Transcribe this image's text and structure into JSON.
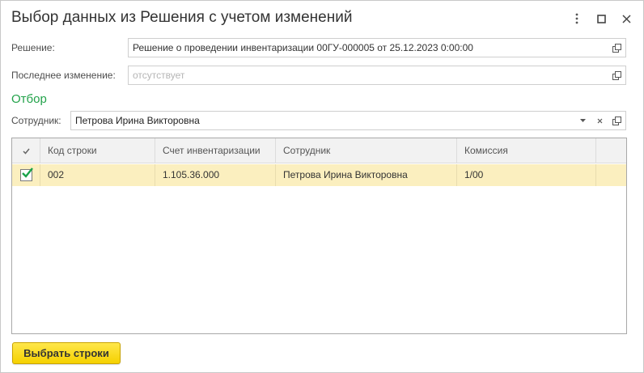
{
  "window": {
    "title": "Выбор данных из Решения с учетом изменений"
  },
  "form": {
    "decision_label": "Решение:",
    "decision_value": "Решение о проведении инвентаризации 00ГУ-000005 от 25.12.2023 0:00:00",
    "last_change_label": "Последнее изменение:",
    "last_change_placeholder": "отсутствует"
  },
  "filter": {
    "title": "Отбор",
    "employee_label": "Сотрудник:",
    "employee_value": "Петрова Ирина Викторовна"
  },
  "table": {
    "columns": [
      "Код строки",
      "Счет инвентаризации",
      "Сотрудник",
      "Комиссия"
    ],
    "rows": [
      {
        "checked": true,
        "code": "002",
        "account": "1.105.36.000",
        "employee": "Петрова Ирина Викторовна",
        "commission": "1/00"
      }
    ]
  },
  "actions": {
    "select_rows_label": "Выбрать строки"
  },
  "colors": {
    "accent_green": "#22a24a",
    "selected_row": "#fbefbf",
    "primary_button": "#f5d100",
    "checkmark": "#1aa34a"
  },
  "icons": {
    "more": "more-vertical-icon",
    "maximize": "maximize-icon",
    "close": "close-icon",
    "open": "open-form-icon",
    "dropdown": "chevron-down-icon",
    "clear": "clear-icon",
    "check": "checkmark-icon"
  }
}
